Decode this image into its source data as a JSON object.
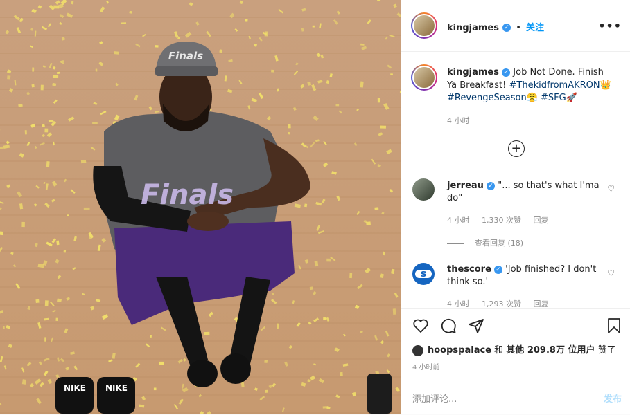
{
  "header": {
    "username": "kingjames",
    "separator": "•",
    "follow_label": "关注",
    "more_icon": "more-horizontal-icon"
  },
  "caption": {
    "username": "kingjames",
    "text_1": "Job Not Done. Finish Ya Breakfast!",
    "tag_1": "#ThekidfromAKRON",
    "emoji_1": "👑",
    "tag_2": "#RevengeSeason",
    "emoji_2": "😤",
    "tag_3": "#SFG",
    "emoji_3": "🚀",
    "time": "4 小时"
  },
  "comments": [
    {
      "username": "jerreau",
      "text": "\"... so that's what I'ma do\"",
      "time": "4 小时",
      "likes": "1,330 次赞",
      "reply": "回复",
      "view_replies": "查看回复 (18)"
    },
    {
      "username": "thescore",
      "text": "'Job finished? I don't think so.'",
      "time": "4 小时",
      "likes": "1,293 次赞",
      "reply": "回复"
    }
  ],
  "likes": {
    "username": "hoopspalace",
    "and": "和",
    "others": "其他 209.8万 位用户",
    "liked": "赞了"
  },
  "post_time": "4 小时前",
  "add_comment": {
    "placeholder": "添加评论...",
    "post_label": "发布"
  },
  "photo_text": {
    "cap": "Finals",
    "shirt": "Finals",
    "slide_brand": "NIKE"
  },
  "colors": {
    "accent": "#0095f6",
    "verified": "#3897f0",
    "hashtag": "#00376b",
    "muted": "#8e8e8e"
  }
}
